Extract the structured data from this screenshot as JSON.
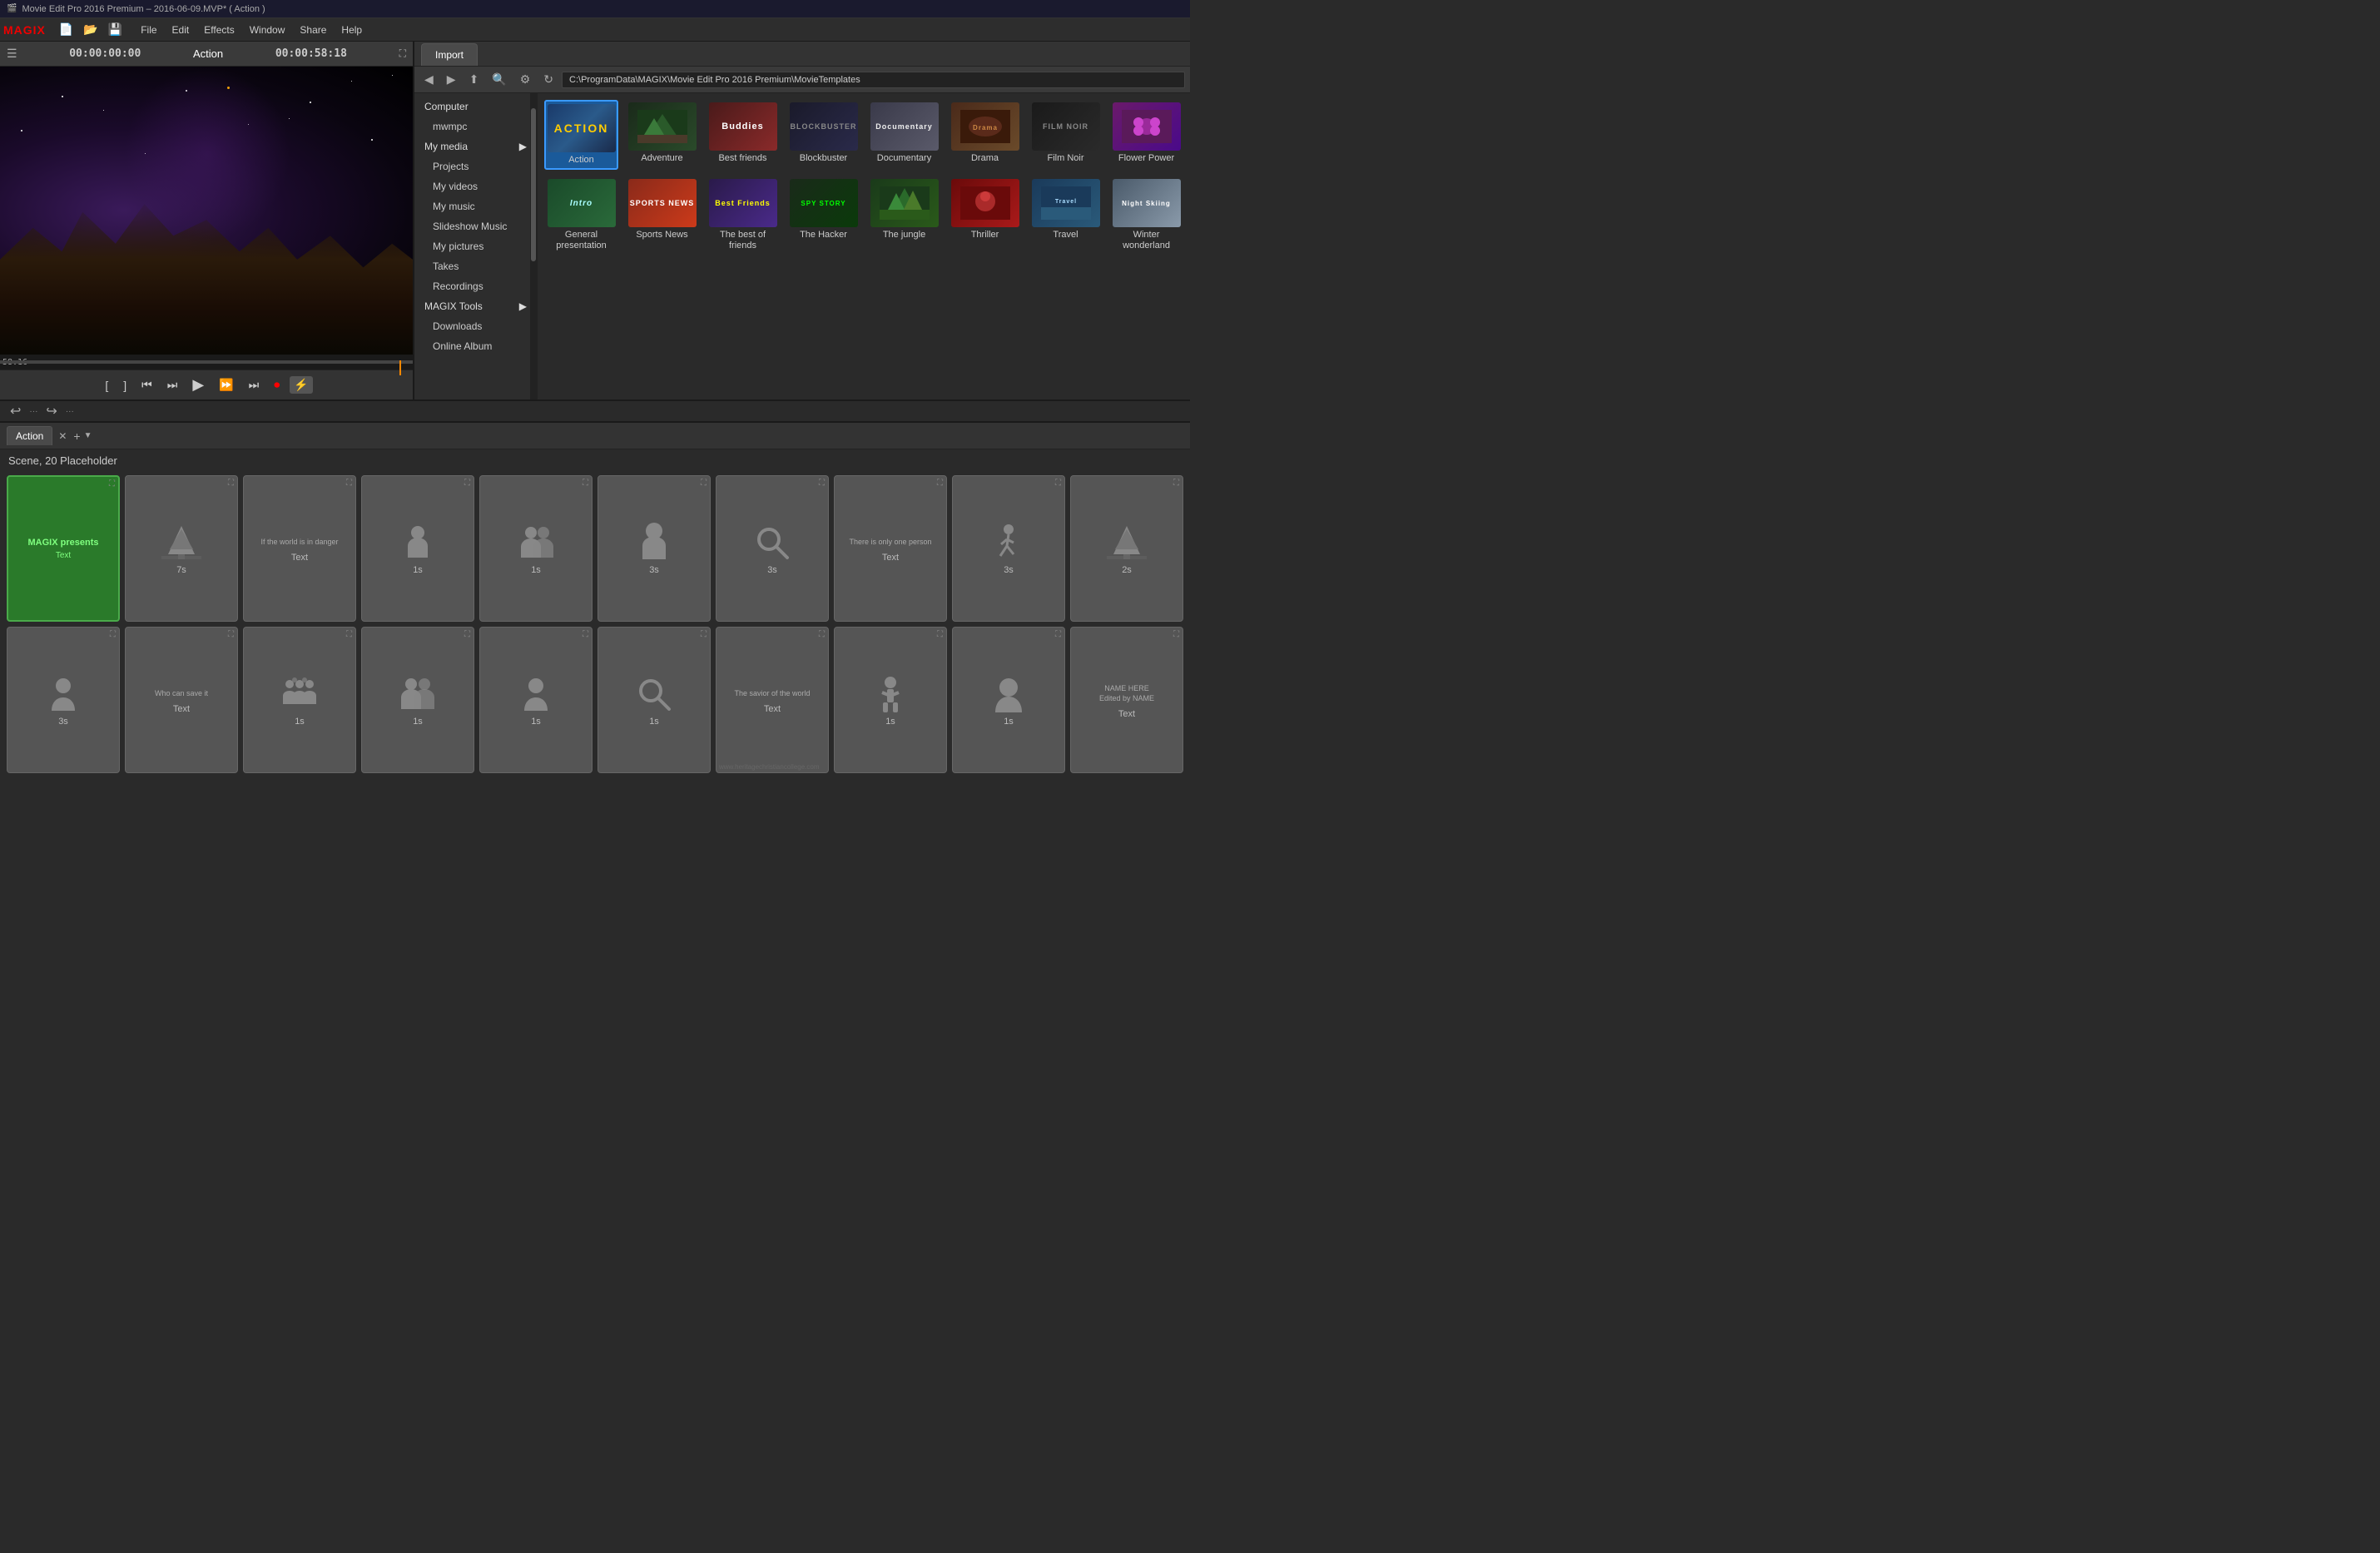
{
  "titlebar": {
    "title": "Movie Edit Pro 2016 Premium – 2016-06-09.MVP* ( Action )",
    "app_icon": "🎬"
  },
  "menubar": {
    "logo": "MAGIX",
    "menu_items": [
      "File",
      "Edit",
      "Effects",
      "Window",
      "Share",
      "Help"
    ],
    "toolbar_icons": [
      "new",
      "open",
      "save"
    ]
  },
  "preview": {
    "timecode_start": "00:00:00:00",
    "title": "Action",
    "timecode_end": "00:00:58:18",
    "time_display": "58:16",
    "controls": [
      "mark-in",
      "mark-out",
      "prev-frame",
      "to-start",
      "play",
      "to-end",
      "next-frame",
      "record",
      "flash"
    ]
  },
  "import": {
    "tab_label": "Import",
    "toolbar": {
      "back": "◀",
      "forward": "▶",
      "up": "⬆",
      "search": "🔍",
      "settings": "⚙",
      "refresh": "↻",
      "path": "C:\\ProgramData\\MAGIX\\Movie Edit Pro 2016 Premium\\MovieTemplates"
    },
    "nav": {
      "items": [
        {
          "label": "Computer",
          "type": "section"
        },
        {
          "label": "mwmpc",
          "type": "sub"
        },
        {
          "label": "My media",
          "type": "section",
          "has_arrow": true
        },
        {
          "label": "Projects",
          "type": "sub"
        },
        {
          "label": "My videos",
          "type": "sub"
        },
        {
          "label": "My music",
          "type": "sub"
        },
        {
          "label": "Slideshow Music",
          "type": "sub"
        },
        {
          "label": "My pictures",
          "type": "sub"
        },
        {
          "label": "Takes",
          "type": "sub"
        },
        {
          "label": "Recordings",
          "type": "sub"
        },
        {
          "label": "MAGIX Tools",
          "type": "section",
          "has_arrow": true
        },
        {
          "label": "Downloads",
          "type": "sub"
        },
        {
          "label": "Online Album",
          "type": "sub"
        }
      ]
    },
    "templates": [
      {
        "id": "action",
        "label": "Action",
        "class": "tmpl-action",
        "text": "ACTION",
        "selected": true
      },
      {
        "id": "adventure",
        "label": "Adventure",
        "class": "tmpl-adventure",
        "text": ""
      },
      {
        "id": "bestfriends",
        "label": "Best friends",
        "class": "tmpl-bestfriends",
        "text": "Buddies"
      },
      {
        "id": "blockbuster",
        "label": "Blockbuster",
        "class": "tmpl-blockbuster",
        "text": "BLOCKBUSTER"
      },
      {
        "id": "documentary",
        "label": "Documentary",
        "class": "tmpl-documentary",
        "text": "Documentary"
      },
      {
        "id": "drama",
        "label": "Drama",
        "class": "tmpl-drama",
        "text": ""
      },
      {
        "id": "filmnoir",
        "label": "Film Noir",
        "class": "tmpl-filmnoir",
        "text": "FILM NOIR"
      },
      {
        "id": "flowerpower",
        "label": "Flower Power",
        "class": "tmpl-flowerpower",
        "text": ""
      },
      {
        "id": "general",
        "label": "General presentation",
        "class": "tmpl-general",
        "text": "Intro"
      },
      {
        "id": "sportsnews",
        "label": "Sports News",
        "class": "tmpl-sportsnews",
        "text": "SPORTS NEWS"
      },
      {
        "id": "bestoffriends",
        "label": "The best of friends",
        "class": "tmpl-bestoffriends",
        "text": "Best Friends"
      },
      {
        "id": "hacker",
        "label": "The Hacker",
        "class": "tmpl-hacker",
        "text": "SPY STORY"
      },
      {
        "id": "jungle",
        "label": "The jungle",
        "class": "tmpl-jungle",
        "text": ""
      },
      {
        "id": "thriller",
        "label": "Thriller",
        "class": "tmpl-thriller",
        "text": ""
      },
      {
        "id": "travel",
        "label": "Travel",
        "class": "tmpl-travel",
        "text": ""
      },
      {
        "id": "winter",
        "label": "Winter wonderland",
        "class": "tmpl-winter",
        "text": "Night Skiing"
      }
    ]
  },
  "timeline": {
    "tab_label": "Action",
    "scene_info": "Scene, 20 Placeholder",
    "placeholders": [
      {
        "id": "ph1",
        "type": "text",
        "label": "MAGIX presents",
        "sublabel": "Text",
        "duration": "",
        "active": true,
        "icon": "none"
      },
      {
        "id": "ph2",
        "type": "icon",
        "label": "",
        "duration": "7s",
        "icon": "tree"
      },
      {
        "id": "ph3",
        "type": "text-only",
        "label": "If the world is in danger",
        "sublabel": "Text",
        "duration": "",
        "icon": "none"
      },
      {
        "id": "ph4",
        "type": "icon",
        "label": "",
        "duration": "1s",
        "icon": "person"
      },
      {
        "id": "ph5",
        "type": "icon",
        "label": "",
        "duration": "1s",
        "icon": "two-persons"
      },
      {
        "id": "ph6",
        "type": "icon",
        "label": "",
        "duration": "3s",
        "icon": "person-lg"
      },
      {
        "id": "ph7",
        "type": "icon",
        "label": "",
        "duration": "3s",
        "icon": "search"
      },
      {
        "id": "ph8",
        "type": "text-only",
        "label": "There is only one person",
        "sublabel": "Text",
        "duration": "",
        "icon": "none"
      },
      {
        "id": "ph9",
        "type": "icon",
        "label": "",
        "duration": "3s",
        "icon": "walk"
      },
      {
        "id": "ph10",
        "type": "icon",
        "label": "",
        "duration": "2s",
        "icon": "tree"
      },
      {
        "id": "ph11",
        "type": "icon",
        "label": "",
        "duration": "3s",
        "icon": "person-circle"
      },
      {
        "id": "ph12",
        "type": "text-only",
        "label": "Who can save it",
        "sublabel": "Text",
        "duration": "",
        "icon": "none"
      },
      {
        "id": "ph13",
        "type": "icon",
        "label": "",
        "duration": "1s",
        "icon": "group3"
      },
      {
        "id": "ph14",
        "type": "icon",
        "label": "",
        "duration": "1s",
        "icon": "group2"
      },
      {
        "id": "ph15",
        "type": "icon",
        "label": "",
        "duration": "1s",
        "icon": "person-circle"
      },
      {
        "id": "ph16",
        "type": "icon",
        "label": "",
        "duration": "1s",
        "icon": "search"
      },
      {
        "id": "ph17",
        "type": "text-only",
        "label": "The savior of the world",
        "sublabel": "Text",
        "duration": "",
        "icon": "none"
      },
      {
        "id": "ph18",
        "type": "icon",
        "label": "",
        "duration": "1s",
        "icon": "person-stand"
      },
      {
        "id": "ph19",
        "type": "icon",
        "label": "",
        "duration": "1s",
        "icon": "person-circle-lg"
      },
      {
        "id": "ph20",
        "type": "text",
        "label": "NAME HERE",
        "sublabel": "Edited by  NAME",
        "extra": "Text",
        "duration": "",
        "icon": "none"
      }
    ],
    "watermark": "www.heritagechristiancollege.com"
  },
  "divider": {
    "undo_label": "↩",
    "redo_label": "↪"
  }
}
